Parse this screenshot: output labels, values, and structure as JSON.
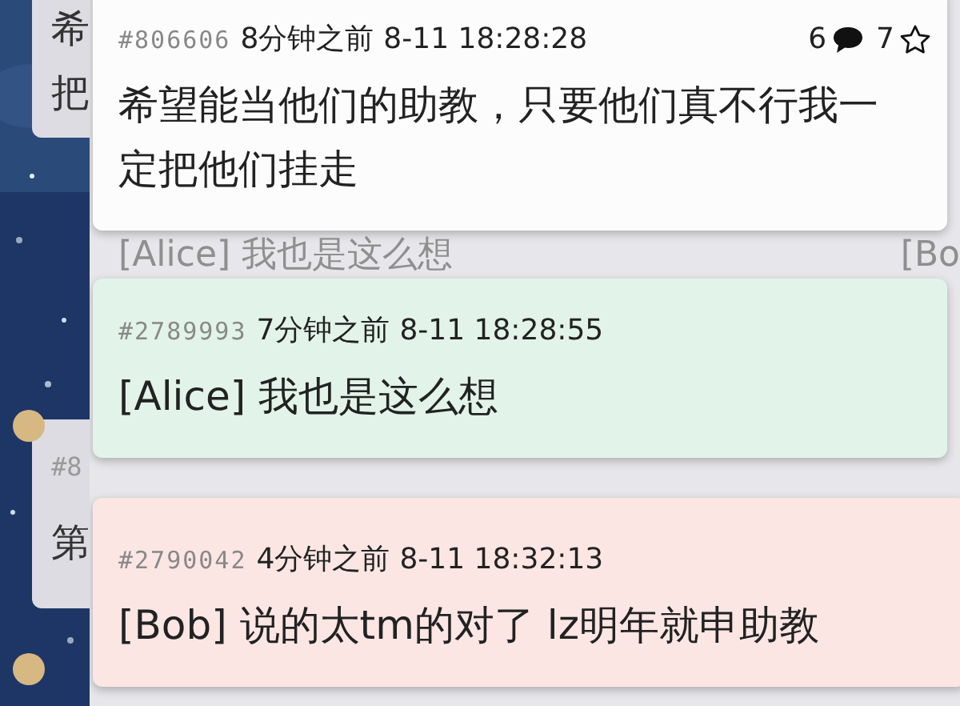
{
  "side_cards": [
    {
      "lines": [
        "希",
        "把"
      ]
    },
    {
      "lines": [
        "#8",
        "第"
      ]
    }
  ],
  "flows": [
    {
      "kind": "post",
      "id": "#806606",
      "time_ago": "8分钟之前",
      "timestamp": "8-11 18:28:28",
      "reply_count": "6",
      "star_count": "7",
      "starred": false,
      "text": "希望能当他们的助教，只要他们真不行我一定把他们挂走",
      "color": "#fdfcfd"
    },
    {
      "kind": "faded",
      "text": "[Alice] 我也是这么想",
      "side": "[Bo"
    },
    {
      "kind": "post",
      "id": "#2789993",
      "time_ago": "7分钟之前",
      "timestamp": "8-11 18:28:55",
      "text": "[Alice] 我也是这么想",
      "color": "#e2f3e9"
    },
    {
      "kind": "faded"
    },
    {
      "kind": "post",
      "id": "#2790042",
      "time_ago": "4分钟之前",
      "timestamp": "8-11 18:32:13",
      "text": "[Bob] 说的太tm的对了 lz明年就申助教",
      "color": "#fbe6e4"
    }
  ]
}
